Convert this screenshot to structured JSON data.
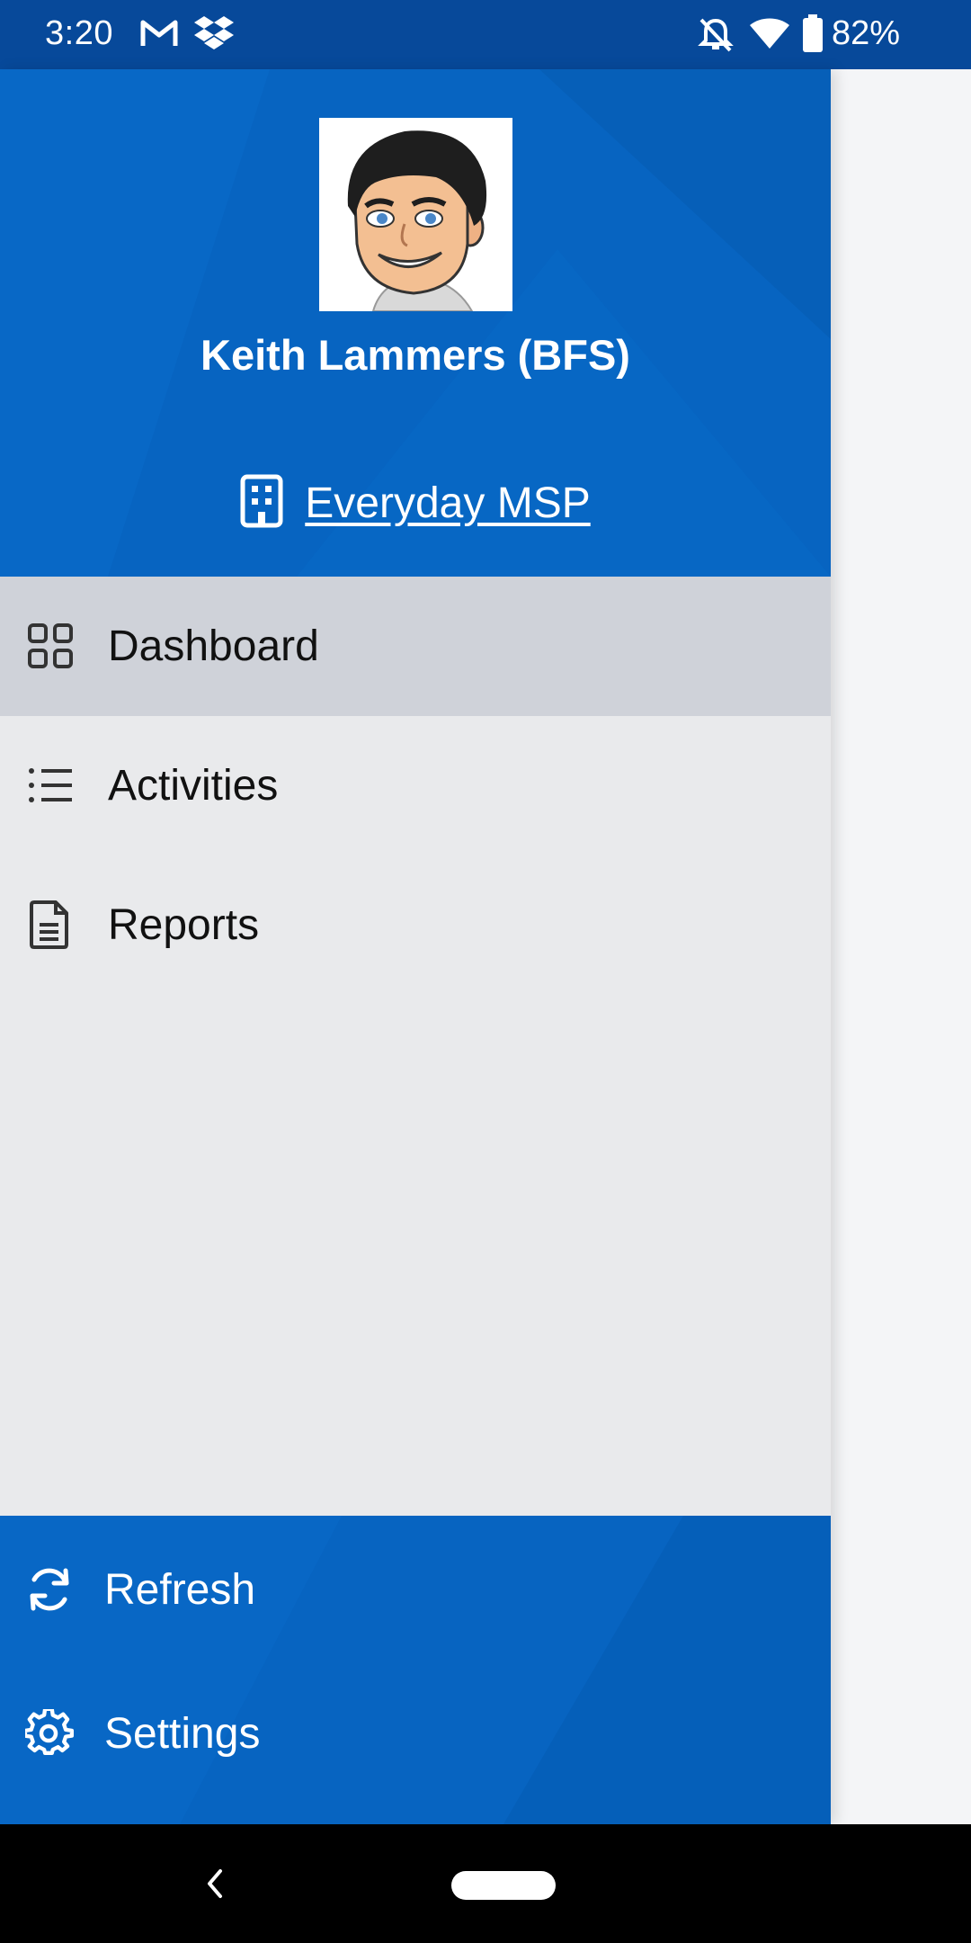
{
  "status_bar": {
    "time": "3:20",
    "notification_icons": [
      "gmail-icon",
      "dropbox-icon"
    ],
    "system_icons": [
      "notifications-off-icon",
      "wifi-icon",
      "battery-icon"
    ],
    "battery": "82%"
  },
  "drawer": {
    "header": {
      "user_name": "Keith Lammers (BFS)",
      "organization": "Everyday MSP",
      "organization_icon": "building-icon",
      "brand_color": "#0764c1"
    },
    "nav_items": [
      {
        "label": "Dashboard",
        "icon": "dashboard-grid-icon",
        "active": true
      },
      {
        "label": "Activities",
        "icon": "list-icon",
        "active": false
      },
      {
        "label": "Reports",
        "icon": "document-icon",
        "active": false
      }
    ],
    "footer_items": [
      {
        "label": "Refresh",
        "icon": "refresh-icon"
      },
      {
        "label": "Settings",
        "icon": "gear-icon"
      }
    ]
  },
  "system_nav": {
    "back": "back-icon",
    "home": "home-pill"
  }
}
